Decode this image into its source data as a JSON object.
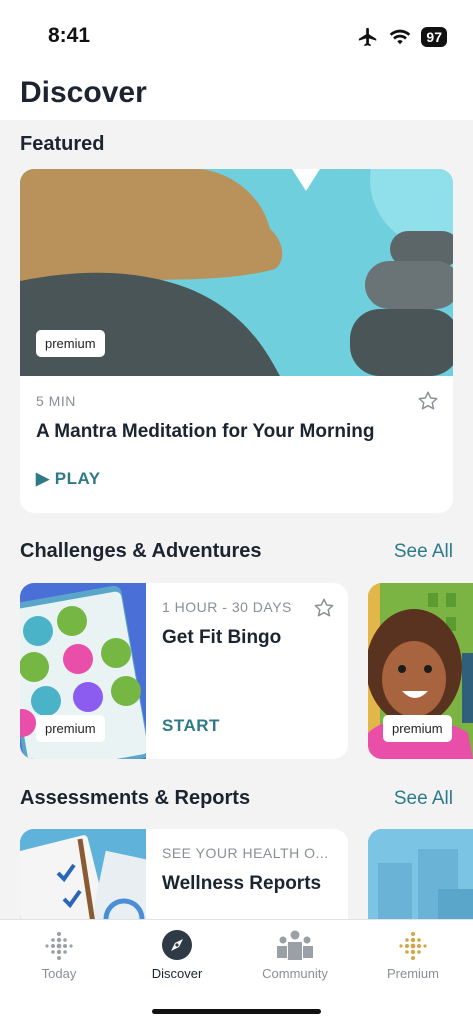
{
  "status_bar": {
    "time": "8:41",
    "battery": "97",
    "icons": [
      "airplane-icon",
      "wifi-icon",
      "battery-icon"
    ]
  },
  "header": {
    "title": "Discover"
  },
  "featured": {
    "section_title": "Featured",
    "card": {
      "badge": "premium",
      "duration": "5 MIN",
      "title": "A Mantra Meditation for Your Morning",
      "action": "▶ PLAY"
    }
  },
  "challenges": {
    "section_title": "Challenges & Adventures",
    "see_all": "See All",
    "cards": [
      {
        "badge": "premium",
        "duration": "1 HOUR - 30 DAYS",
        "title": "Get Fit Bingo",
        "action": "START"
      },
      {
        "badge": "premium"
      }
    ]
  },
  "assessments": {
    "section_title": "Assessments & Reports",
    "see_all": "See All",
    "cards": [
      {
        "caption": "SEE YOUR HEALTH O...",
        "title": "Wellness Reports"
      }
    ]
  },
  "tab_bar": {
    "tabs": [
      {
        "label": "Today",
        "icon": "today-dots-icon",
        "active": false
      },
      {
        "label": "Discover",
        "icon": "compass-icon",
        "active": true
      },
      {
        "label": "Community",
        "icon": "community-icon",
        "active": false
      },
      {
        "label": "Premium",
        "icon": "premium-dots-icon",
        "active": false
      }
    ]
  },
  "colors": {
    "accent": "#2f7a88",
    "title": "#1c2430",
    "muted": "#8a8f96",
    "background": "#f3f3f4",
    "premium_gold": "#d4a34a"
  }
}
